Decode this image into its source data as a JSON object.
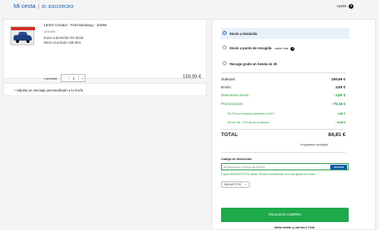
{
  "header": {
    "title": "Mi cesta",
    "separator": "|",
    "cart_id": "ID: E00109K36X",
    "help_label": "Ayuda",
    "help_icon_glyph": "?"
  },
  "product": {
    "name": "LEGO Creator - Ford Mustang - 10265",
    "ref": "2210409",
    "shipping": "Envío a domicilio: En Stock",
    "stock": "Recio el artículo 159,99 €",
    "unit_price": "",
    "qty_label": "Cantidad:",
    "qty_minus": "-",
    "qty_value": "1",
    "qty_plus": "+",
    "line_price": "159,99 €",
    "remove_label": "ELIMINAR",
    "fav_label": "MOVER A FAVORITOS"
  },
  "message": {
    "label": "+ Adjunta un mensaje personalizado a tu envío"
  },
  "delivery": {
    "options": [
      {
        "label": "Envío a domicilio",
        "info": "",
        "selected": true
      },
      {
        "label": "Envío a punto de recogida",
        "info": "saber más",
        "selected": false
      },
      {
        "label": "Recoge gratis en tienda en 2h",
        "info": "",
        "selected": false
      }
    ],
    "info_icon_glyph": "i"
  },
  "summary": {
    "subtotal_label": "Subtotal:",
    "subtotal_value": "159,99 €",
    "shipping_label": "Envío:",
    "shipping_value": "3,80 €",
    "ship_discount_label": "Descuento envío:",
    "ship_discount_value": "- 3,80 €",
    "promo_label": "Promociones:",
    "promo_value": "- 75,18 €",
    "promo1_label": "95,73% por compras superiores a 149 €",
    "promo1_value": "- 9,60 €",
    "promo2_label": "Día sin IVA - 21% día de la semana",
    "promo2_value": "- 33,69 €",
    "total_label": "TOTAL",
    "total_value": "84,81 €",
    "tax_note": "*Impuestos incluidos."
  },
  "coupon": {
    "title": "Código de descuento",
    "placeholder": "INTRODUCE EL CÓDIGO DE CUPÓN",
    "apply_label": "APLICAR",
    "success_text": "Cupón RADIAPTOTIS válido. Revisa condiciones si no se aplica con éxito.",
    "chip_label": "RADIAPTOTIS",
    "chip_close": "×"
  },
  "checkout": {
    "button_label": "FINALIZAR COMPRA",
    "login_club": "Inicia sesión y usa tus € Club"
  },
  "colors": {
    "brand_blue": "#0a5aa8",
    "success_green": "#1eaa4a",
    "discount_green": "#1c9a3c"
  }
}
